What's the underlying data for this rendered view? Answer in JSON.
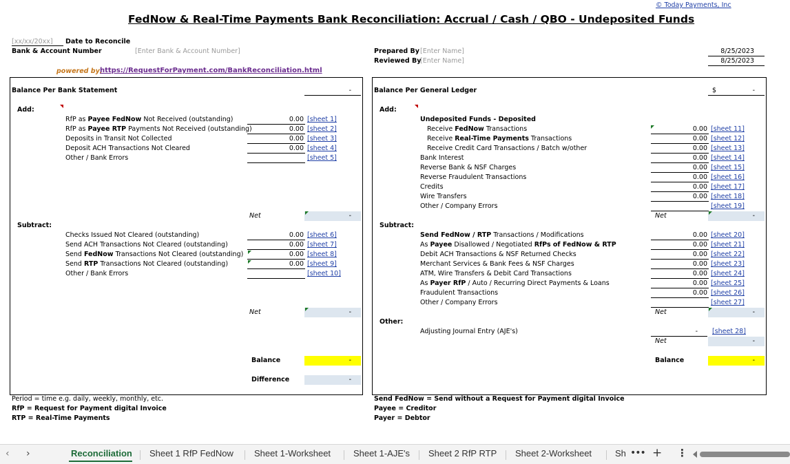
{
  "header": {
    "company_link": "© Today Payments, Inc",
    "title": "FedNow & Real-Time Payments Bank Reconciliation:  Accrual / Cash / QBO - Undeposited Funds",
    "date_placeholder": "[xx/xx/20xx]",
    "date_label": "Date to Reconcile",
    "bank_label": "Bank & Account Number",
    "bank_placeholder": "[Enter Bank & Account Number]",
    "prepared_label": "Prepared By",
    "prepared_placeholder": "[Enter Name]",
    "reviewed_label": "Reviewed By",
    "reviewed_placeholder": "[Enter Name]",
    "prepared_date": "8/25/2023",
    "reviewed_date": "8/25/2023",
    "powered_label": "powered by:",
    "powered_link": "https://RequestForPayment.com/BankReconciliation.html"
  },
  "left": {
    "heading": "Balance Per Bank Statement",
    "heading_value": "-",
    "add_label": "Add:",
    "add_items": [
      {
        "pre": "RfP as ",
        "b1": "Payee FedNow",
        "post": " Not Received (outstanding)",
        "value": "0.00",
        "sheet": "[sheet 1]"
      },
      {
        "pre": "RfP as ",
        "b1": "Payee RTP",
        "post": " Payments Not Received (outstanding)",
        "value": "0.00",
        "sheet": "[sheet 2]"
      },
      {
        "pre": "Deposits in Transit Not Collected",
        "b1": "",
        "post": "",
        "value": "0.00",
        "sheet": "[sheet 3]"
      },
      {
        "pre": "Deposit ACH Transactions Not Cleared",
        "b1": "",
        "post": "",
        "value": "0.00",
        "sheet": "[sheet 4]"
      },
      {
        "pre": "Other / Bank Errors",
        "b1": "",
        "post": "",
        "value": "",
        "sheet": "[sheet 5]"
      }
    ],
    "net1_label": "Net",
    "net1_value": "-",
    "subtract_label": "Subtract:",
    "sub_items": [
      {
        "pre": "Checks Issued Not Cleared (outstanding)",
        "b1": "",
        "post": "",
        "value": "0.00",
        "sheet": "[sheet 6]"
      },
      {
        "pre": "Send ACH Transactions Not Cleared (outstanding)",
        "b1": "",
        "post": "",
        "value": "0.00",
        "sheet": "[sheet 7]"
      },
      {
        "pre": "Send ",
        "b1": "FedNow",
        "post": " Transactions Not Cleared (outstanding)",
        "value": "0.00",
        "sheet": "[sheet 8]"
      },
      {
        "pre": "Send ",
        "b1": "RTP",
        "post": " Transactions Not Cleared (outstanding)",
        "value": "0.00",
        "sheet": "[sheet 9]"
      },
      {
        "pre": "Other / Bank Errors",
        "b1": "",
        "post": "",
        "value": "",
        "sheet": "[sheet 10]"
      }
    ],
    "net2_label": "Net",
    "net2_value": "-",
    "balance_label": "Balance",
    "balance_value": "-",
    "difference_label": "Difference",
    "difference_value": "-"
  },
  "right": {
    "heading": "Balance Per General Ledger",
    "heading_currency": "$",
    "heading_value": "-",
    "add_label": "Add:",
    "undeposited_label": "Undeposited Funds - Deposited",
    "add_items": [
      {
        "pre": "Receive ",
        "b1": "FedNow",
        "post": " Transactions",
        "indent": true,
        "value": "0.00",
        "sheet": "[sheet 11]"
      },
      {
        "pre": "Receive ",
        "b1": "Real-Time Payments",
        "post": " Transactions",
        "indent": true,
        "value": "0.00",
        "sheet": "[sheet 12]"
      },
      {
        "pre": "Receive Credit Card Transactions / Batch w/other",
        "b1": "",
        "post": "",
        "indent": true,
        "value": "0.00",
        "sheet": "[sheet 13]"
      },
      {
        "pre": "Bank Interest",
        "b1": "",
        "post": "",
        "indent": false,
        "value": "0.00",
        "sheet": "[sheet 14]"
      },
      {
        "pre": "Reverse Bank & NSF Charges",
        "b1": "",
        "post": "",
        "indent": false,
        "value": "0.00",
        "sheet": "[sheet 15]"
      },
      {
        "pre": "Reverse Fraudulent Transactions",
        "b1": "",
        "post": "",
        "indent": false,
        "value": "0.00",
        "sheet": "[sheet 16]"
      },
      {
        "pre": "Credits",
        "b1": "",
        "post": "",
        "indent": false,
        "value": "0.00",
        "sheet": "[sheet 17]"
      },
      {
        "pre": "Wire Transfers",
        "b1": "",
        "post": "",
        "indent": false,
        "value": "0.00",
        "sheet": "[sheet 18]"
      },
      {
        "pre": "Other / Company Errors",
        "b1": "",
        "post": "",
        "indent": false,
        "value": "",
        "sheet": "[sheet 19]"
      }
    ],
    "net1_label": "Net",
    "net1_value": "-",
    "subtract_label": "Subtract:",
    "sub_items": [
      {
        "pre": "",
        "b1": "Send FedNow / RTP",
        "post": " Transactions / Modifications",
        "value": "0.00",
        "sheet": "[sheet 20]"
      },
      {
        "pre": "As ",
        "b1": "Payee",
        "post": " Disallowed / Negotiated ",
        "b2": "RfPs of FedNow & RTP",
        "value": "0.00",
        "sheet": "[sheet 21]"
      },
      {
        "pre": "Debit ACH Transactions & NSF Returned Checks",
        "b1": "",
        "post": "",
        "value": "0.00",
        "sheet": "[sheet 22]"
      },
      {
        "pre": "Merchant Services & Bank Fees & NSF Charges",
        "b1": "",
        "post": "",
        "value": "0.00",
        "sheet": "[sheet 23]"
      },
      {
        "pre": "ATM, Wire Transfers & Debit Card Transactions",
        "b1": "",
        "post": "",
        "value": "0.00",
        "sheet": "[sheet 24]"
      },
      {
        "pre": "As ",
        "b1": "Payer RfP",
        "post": " / Auto / Recurring Direct Payments & Loans",
        "value": "0.00",
        "sheet": "[sheet 25]"
      },
      {
        "pre": "Fraudulent Transactions",
        "b1": "",
        "post": "",
        "value": "0.00",
        "sheet": "[sheet 26]"
      },
      {
        "pre": "Other / Company Errors",
        "b1": "",
        "post": "",
        "value": "",
        "sheet": "[sheet 27]"
      }
    ],
    "net2_label": "Net",
    "net2_value": "-",
    "other_label": "Other:",
    "aje_label": "Adjusting Journal Entry (AJE's)",
    "aje_value": "-",
    "aje_sheet": "[sheet 28]",
    "net3_label": "Net",
    "net3_value": "-",
    "balance_label": "Balance",
    "balance_value": "-"
  },
  "footnotes": {
    "period": "Period = time e.g. daily, weekly, monthly, etc.",
    "rfp": "RfP = Request for Payment digital Invoice",
    "rtp": "RTP = Real-Time Payments",
    "send_fednow": "Send FedNow = Send without a Request for Payment digital Invoice",
    "payee": "Payee = Creditor",
    "payer": "Payer = Debtor"
  },
  "tabs": [
    "Reconciliation",
    "Sheet 1 RfP FedNow",
    "Sheet 1-Worksheet",
    "Sheet 1-AJE's",
    "Sheet 2 RfP RTP",
    "Sheet 2-Worksheet",
    "Sh"
  ],
  "icons": {
    "prev": "chevron-left-icon",
    "next": "chevron-right-icon",
    "more": "more-icon",
    "add": "plus-icon",
    "options": "vertical-dots-icon"
  }
}
